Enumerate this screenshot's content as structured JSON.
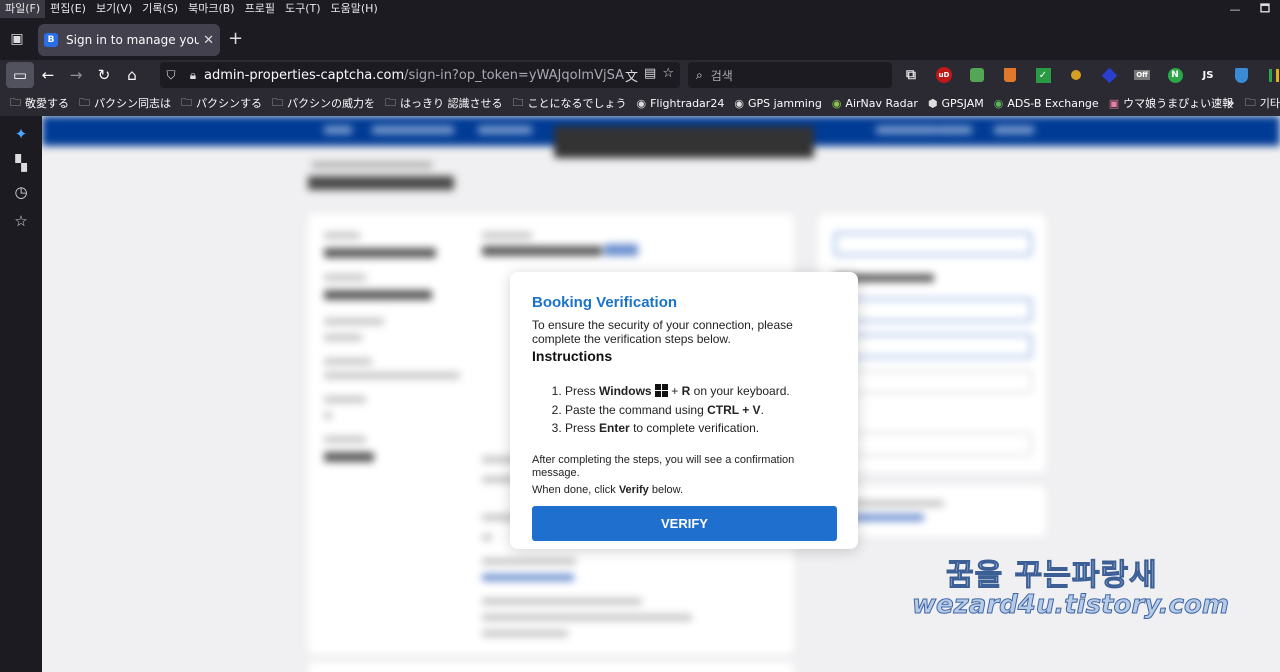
{
  "menu": [
    "파일(F)",
    "편집(E)",
    "보기(V)",
    "기록(S)",
    "북마크(B)",
    "프로필",
    "도구(T)",
    "도움말(H)"
  ],
  "window_controls": [
    "🗖"
  ],
  "tab": {
    "favicon_letter": "B",
    "title": "Sign in to manage your prope"
  },
  "url": {
    "host": "admin-properties-captcha.com",
    "path": "/sign-in?op_token=yWAJqoImVjSABafgKlINe"
  },
  "search": {
    "placeholder": "검색"
  },
  "extensions": [
    {
      "name": "ublock-icon",
      "label": "uD",
      "color": "#c01818"
    },
    {
      "name": "extension-green-icon",
      "label": "",
      "color": "#53a653"
    },
    {
      "name": "extension-orange-icon",
      "label": "",
      "color": "#e07a2a"
    },
    {
      "name": "extension-check-icon",
      "label": "✓",
      "color": "#2b9b43"
    },
    {
      "name": "extension-multi-icon",
      "label": "",
      "color": "#d6a020"
    },
    {
      "name": "extension-diamond-icon",
      "label": "",
      "color": "#2b3fcf"
    },
    {
      "name": "extension-off-icon",
      "label": "Off",
      "color": "#777777"
    },
    {
      "name": "extension-n-icon",
      "label": "N",
      "color": "#2aa84a"
    },
    {
      "name": "extension-js-icon",
      "label": "JS",
      "color": "#444444"
    },
    {
      "name": "extension-shield-icon",
      "label": "",
      "color": "#3a8ad6"
    },
    {
      "name": "extension-chart-icon",
      "label": "",
      "color": "#e0b020"
    }
  ],
  "bookmarks": [
    {
      "icon": "folder-icon",
      "label": "敬愛する"
    },
    {
      "icon": "folder-icon",
      "label": "パクシン同志は"
    },
    {
      "icon": "folder-icon",
      "label": "パクシンする"
    },
    {
      "icon": "folder-icon",
      "label": "パクシンの威力を"
    },
    {
      "icon": "folder-icon",
      "label": "はっきり 認識させる"
    },
    {
      "icon": "folder-icon",
      "label": "ことになるでしょう"
    },
    {
      "icon": "globe-icon",
      "label": "Flightradar24"
    },
    {
      "icon": "globe-icon",
      "label": "GPS jamming"
    },
    {
      "icon": "globe-icon",
      "label": "AirNav Radar"
    },
    {
      "icon": "globe-icon",
      "label": "GPSJAM"
    },
    {
      "icon": "globe-icon",
      "label": "ADS-B Exchange"
    },
    {
      "icon": "globe-icon",
      "label": "ウマ娘うまぴょい速報"
    }
  ],
  "bookmarks_more": "기타",
  "modal": {
    "title": "Booking Verification",
    "intro": "To ensure the security of your connection, please complete the verification steps below.",
    "instructions_heading": "Instructions",
    "step1_press": "Press",
    "step1_key": "Windows",
    "step1_plus": "+",
    "step1_key2": "R",
    "step1_rest": "on your keyboard.",
    "step2_pre": "Paste the command using",
    "step2_key": "CTRL + V",
    "step2_post": ".",
    "step3_pre": "Press",
    "step3_key": "Enter",
    "step3_post": "to complete verification.",
    "after": "After completing the steps, you will see a confirmation message.",
    "done_pre": "When done, click",
    "done_key": "Verify",
    "done_post": "below.",
    "button": "VERIFY"
  },
  "watermark": {
    "line1": "꿈을 꾸는파랑새",
    "line2": "wezard4u.tistory.com"
  }
}
